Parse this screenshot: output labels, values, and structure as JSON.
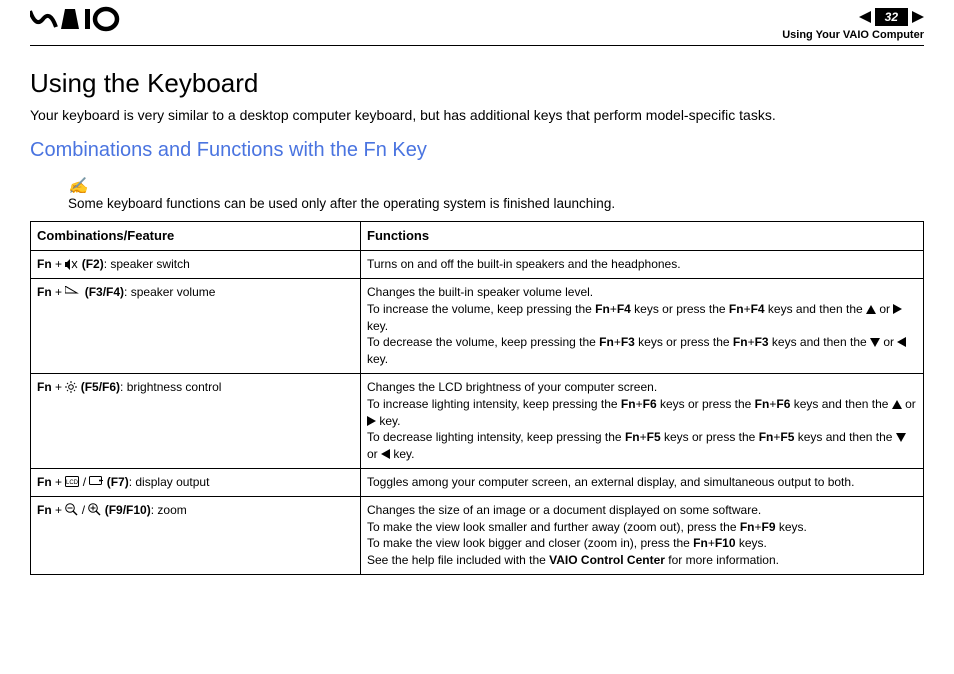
{
  "header": {
    "logo_alt": "VAIO",
    "page_number": "32",
    "section": "Using Your VAIO Computer"
  },
  "title": "Using the Keyboard",
  "intro": "Your keyboard is very similar to a desktop computer keyboard, but has additional keys that perform model-specific tasks.",
  "subtitle": "Combinations and Functions with the Fn Key",
  "note_icon": "✍",
  "note": "Some keyboard functions can be used only after the operating system is finished launching.",
  "table": {
    "head": {
      "col1": "Combinations/Feature",
      "col2": "Functions"
    },
    "rows": {
      "r0": {
        "fn": "Fn",
        "plus": " + ",
        "key": "(F2)",
        "desc": ": speaker switch",
        "func": "Turns on and off the built-in speakers and the headphones."
      },
      "r1": {
        "fn": "Fn",
        "plus": " + ",
        "key": "(F3/F4)",
        "desc": ": speaker volume",
        "f_line1": "Changes the built-in speaker volume level.",
        "f_inc_a": "To increase the volume, keep pressing the ",
        "f_inc_k1": "Fn",
        "f_inc_p": "+",
        "f_inc_k2": "F4",
        "f_inc_b": " keys or press the ",
        "f_inc_k3": "Fn",
        "f_inc_k4": "F4",
        "f_inc_c": " keys and then the ",
        "f_or": " or ",
        "f_key": " key.",
        "f_dec_a": "To decrease the volume, keep pressing the ",
        "f_dec_k1": "Fn",
        "f_dec_k2": "F3",
        "f_dec_b": " keys or press the ",
        "f_dec_k3": "Fn",
        "f_dec_k4": "F3",
        "f_dec_c": " keys and then the "
      },
      "r2": {
        "fn": "Fn",
        "plus": " + ",
        "key": "(F5/F6)",
        "desc": ": brightness control",
        "f_line1": "Changes the LCD brightness of your computer screen.",
        "f_inc_a": "To increase lighting intensity, keep pressing the ",
        "f_inc_k1": "Fn",
        "f_inc_p": "+",
        "f_inc_k2": "F6",
        "f_inc_b": " keys or press the ",
        "f_inc_k3": "Fn",
        "f_inc_k4": "F6",
        "f_inc_c": " keys and then the ",
        "f_or": " or ",
        "f_key": " key.",
        "f_dec_a": "To decrease lighting intensity, keep pressing the ",
        "f_dec_k1": "Fn",
        "f_dec_k2": "F5",
        "f_dec_b": " keys or press the ",
        "f_dec_k3": "Fn",
        "f_dec_k4": "F5",
        "f_dec_c": " keys and then the "
      },
      "r3": {
        "fn": "Fn",
        "plus": " + ",
        "slash": " / ",
        "key": "(F7)",
        "desc": ": display output",
        "func": "Toggles among your computer screen, an external display, and simultaneous output to both."
      },
      "r4": {
        "fn": "Fn",
        "plus": " + ",
        "slash": " / ",
        "key": "(F9/F10)",
        "desc": ": zoom",
        "l1": "Changes the size of an image or a document displayed on some software.",
        "l2a": "To make the view look smaller and further away (zoom out), press the ",
        "l2k": "Fn",
        "l2p": "+",
        "l2k2": "F9",
        "l2b": " keys.",
        "l3a": "To make the view look bigger and closer (zoom in), press the ",
        "l3k": "Fn",
        "l3k2": "F10",
        "l3b": " keys.",
        "l4a": "See the help file included with the ",
        "l4b": "VAIO Control Center",
        "l4c": " for more information."
      }
    }
  }
}
